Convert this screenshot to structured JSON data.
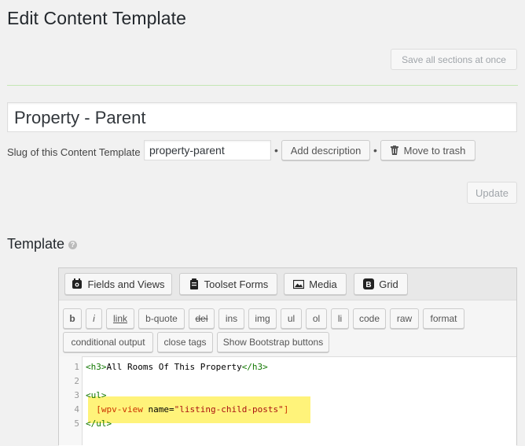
{
  "page": {
    "title": "Edit Content Template"
  },
  "top_actions": {
    "save_all": "Save all sections at once"
  },
  "template_title": {
    "value": "Property - Parent"
  },
  "slug": {
    "label": "Slug of this Content Template",
    "value": "property-parent",
    "separator": "•",
    "add_description": "Add description",
    "move_to_trash": "Move to trash"
  },
  "update_button": "Update",
  "template_section": {
    "title": "Template",
    "help_icon": "?"
  },
  "editor_toolbar": {
    "fields_and_views": "Fields and Views",
    "toolset_forms": "Toolset Forms",
    "media": "Media",
    "grid": "Grid"
  },
  "quicktags": {
    "row1": [
      "b",
      "i",
      "link",
      "b-quote",
      "del",
      "ins",
      "img",
      "ul",
      "ol",
      "li",
      "code",
      "raw",
      "format"
    ],
    "row2": [
      "conditional output",
      "close tags",
      "Show Bootstrap buttons"
    ]
  },
  "code_lines": [
    {
      "num": "1",
      "parts": [
        [
          "tag",
          "<h3>"
        ],
        [
          "txt",
          "All Rooms Of This Property"
        ],
        [
          "tag",
          "</h3>"
        ]
      ]
    },
    {
      "num": "2",
      "parts": []
    },
    {
      "num": "3",
      "parts": [
        [
          "tag",
          "<ul>"
        ]
      ]
    },
    {
      "num": "4",
      "parts": [
        [
          "txt",
          "  "
        ],
        [
          "sc",
          "[wpv-view"
        ],
        [
          "txt",
          " name="
        ],
        [
          "str",
          "\"listing-child-posts\""
        ],
        [
          "sc",
          "]"
        ]
      ]
    },
    {
      "num": "5",
      "parts": [
        [
          "tag",
          "</ul>"
        ]
      ]
    }
  ],
  "colors": {
    "highlight": "#fff37a",
    "divider": "#c3e6b4",
    "tag": "#117700",
    "shortcode": "#cc3300",
    "string": "#aa1111"
  }
}
